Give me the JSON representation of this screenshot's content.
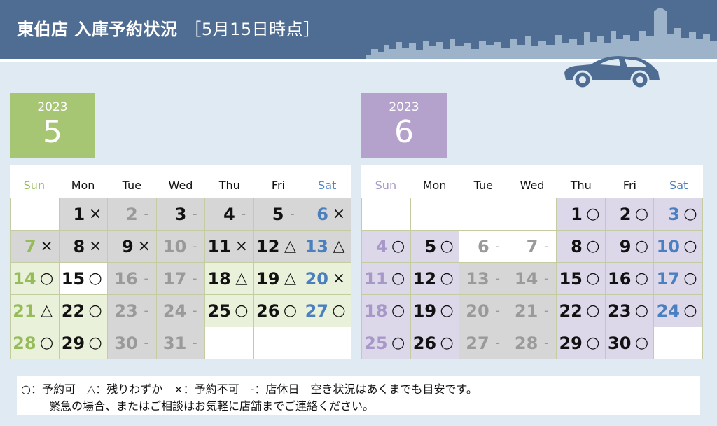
{
  "header": {
    "title": "東伯店 入庫予約状況",
    "subtitle": "［5月15日時点］",
    "colors": {
      "band": "#4f6d93",
      "skyline": "#9db3ca"
    }
  },
  "weekdays": [
    "Sun",
    "Mon",
    "Tue",
    "Wed",
    "Thu",
    "Fri",
    "Sat"
  ],
  "colors": {
    "sat": "#4a7fc0",
    "available_bg": "#eaf1da",
    "available_bg_june": "#ddd7ea",
    "closed_fg": "#9a9a9a",
    "past_bg": "#d6d6d6",
    "white_bg": "#ffffff"
  },
  "calendars": [
    {
      "year": "2023",
      "month": "5",
      "tile_color": "#a6c673",
      "sun_color": "#96bc5a",
      "weeks": [
        [
          {
            "d": "",
            "m": "",
            "s": "empty"
          },
          {
            "d": "1",
            "m": "×",
            "s": "past"
          },
          {
            "d": "2",
            "m": "-",
            "s": "past-closed"
          },
          {
            "d": "3",
            "m": "-",
            "s": "past-sun"
          },
          {
            "d": "4",
            "m": "-",
            "s": "past-sun"
          },
          {
            "d": "5",
            "m": "-",
            "s": "past-sun"
          },
          {
            "d": "6",
            "m": "×",
            "s": "past-sat"
          }
        ],
        [
          {
            "d": "7",
            "m": "×",
            "s": "past-sun"
          },
          {
            "d": "8",
            "m": "×",
            "s": "past"
          },
          {
            "d": "9",
            "m": "×",
            "s": "past"
          },
          {
            "d": "10",
            "m": "-",
            "s": "past-closed"
          },
          {
            "d": "11",
            "m": "×",
            "s": "past"
          },
          {
            "d": "12",
            "m": "△",
            "s": "past"
          },
          {
            "d": "13",
            "m": "△",
            "s": "past-sat"
          }
        ],
        [
          {
            "d": "14",
            "m": "○",
            "s": "avail-sun"
          },
          {
            "d": "15",
            "m": "○",
            "s": "white"
          },
          {
            "d": "16",
            "m": "-",
            "s": "past-closed"
          },
          {
            "d": "17",
            "m": "-",
            "s": "past-closed"
          },
          {
            "d": "18",
            "m": "△",
            "s": "avail"
          },
          {
            "d": "19",
            "m": "△",
            "s": "avail"
          },
          {
            "d": "20",
            "m": "×",
            "s": "avail-sat"
          }
        ],
        [
          {
            "d": "21",
            "m": "△",
            "s": "avail-sun"
          },
          {
            "d": "22",
            "m": "○",
            "s": "avail"
          },
          {
            "d": "23",
            "m": "-",
            "s": "past-closed"
          },
          {
            "d": "24",
            "m": "-",
            "s": "past-closed"
          },
          {
            "d": "25",
            "m": "○",
            "s": "avail"
          },
          {
            "d": "26",
            "m": "○",
            "s": "avail"
          },
          {
            "d": "27",
            "m": "○",
            "s": "avail-sat"
          }
        ],
        [
          {
            "d": "28",
            "m": "○",
            "s": "avail-sun"
          },
          {
            "d": "29",
            "m": "○",
            "s": "avail"
          },
          {
            "d": "30",
            "m": "-",
            "s": "past-closed"
          },
          {
            "d": "31",
            "m": "-",
            "s": "past-closed"
          },
          {
            "d": "",
            "m": "",
            "s": "empty"
          },
          {
            "d": "",
            "m": "",
            "s": "empty"
          },
          {
            "d": "",
            "m": "",
            "s": "empty"
          }
        ]
      ]
    },
    {
      "year": "2023",
      "month": "6",
      "tile_color": "#b4a2cc",
      "sun_color": "#a898c8",
      "weeks": [
        [
          {
            "d": "",
            "m": "",
            "s": "empty"
          },
          {
            "d": "",
            "m": "",
            "s": "empty"
          },
          {
            "d": "",
            "m": "",
            "s": "empty"
          },
          {
            "d": "",
            "m": "",
            "s": "empty"
          },
          {
            "d": "1",
            "m": "○",
            "s": "avail"
          },
          {
            "d": "2",
            "m": "○",
            "s": "avail"
          },
          {
            "d": "3",
            "m": "○",
            "s": "avail-sat"
          }
        ],
        [
          {
            "d": "4",
            "m": "○",
            "s": "avail-sun"
          },
          {
            "d": "5",
            "m": "○",
            "s": "avail"
          },
          {
            "d": "6",
            "m": "-",
            "s": "closed"
          },
          {
            "d": "7",
            "m": "-",
            "s": "closed"
          },
          {
            "d": "8",
            "m": "○",
            "s": "avail"
          },
          {
            "d": "9",
            "m": "○",
            "s": "avail"
          },
          {
            "d": "10",
            "m": "○",
            "s": "avail-sat"
          }
        ],
        [
          {
            "d": "11",
            "m": "○",
            "s": "avail-sun"
          },
          {
            "d": "12",
            "m": "○",
            "s": "avail"
          },
          {
            "d": "13",
            "m": "-",
            "s": "past-closed"
          },
          {
            "d": "14",
            "m": "-",
            "s": "past-closed"
          },
          {
            "d": "15",
            "m": "○",
            "s": "avail"
          },
          {
            "d": "16",
            "m": "○",
            "s": "avail"
          },
          {
            "d": "17",
            "m": "○",
            "s": "avail-sat"
          }
        ],
        [
          {
            "d": "18",
            "m": "○",
            "s": "avail-sun"
          },
          {
            "d": "19",
            "m": "○",
            "s": "avail"
          },
          {
            "d": "20",
            "m": "-",
            "s": "past-closed"
          },
          {
            "d": "21",
            "m": "-",
            "s": "past-closed"
          },
          {
            "d": "22",
            "m": "○",
            "s": "avail"
          },
          {
            "d": "23",
            "m": "○",
            "s": "avail"
          },
          {
            "d": "24",
            "m": "○",
            "s": "avail-sat"
          }
        ],
        [
          {
            "d": "25",
            "m": "○",
            "s": "avail-sun"
          },
          {
            "d": "26",
            "m": "○",
            "s": "avail"
          },
          {
            "d": "27",
            "m": "-",
            "s": "past-closed"
          },
          {
            "d": "28",
            "m": "-",
            "s": "past-closed"
          },
          {
            "d": "29",
            "m": "○",
            "s": "avail"
          },
          {
            "d": "30",
            "m": "○",
            "s": "avail"
          },
          {
            "d": "",
            "m": "",
            "s": "empty"
          }
        ]
      ]
    }
  ],
  "legend": {
    "line1": "○：予約可　△：残りわずか　×：予約不可　-：店休日　空き状況はあくまでも目安です。",
    "line2": "緊急の場合、またはご相談はお気軽に店舗までご連絡ください。"
  }
}
